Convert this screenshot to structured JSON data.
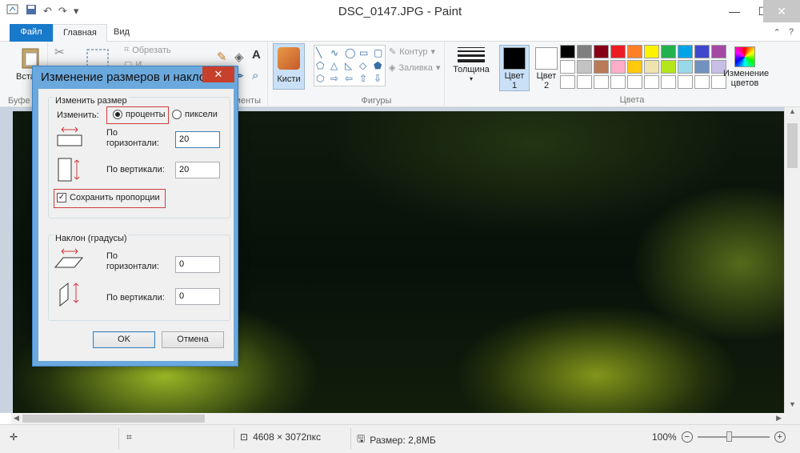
{
  "window": {
    "title": "DSC_0147.JPG - Paint",
    "minimize_glyph": "—",
    "maximize_glyph": "☐",
    "close_glyph": "✕"
  },
  "quick_access": {
    "app_icon": "paint-icon",
    "save_icon": "save-icon",
    "undo_icon": "undo-icon",
    "redo_icon": "redo-icon",
    "dropdown_glyph": "▾"
  },
  "tabs": [
    {
      "label": "Файл"
    },
    {
      "label": "Главная"
    },
    {
      "label": "Вид"
    }
  ],
  "ribbon": {
    "clipboard": {
      "paste_label": "Вста",
      "group_label": "Буфе"
    },
    "image": {
      "crop_label": "Обрезать",
      "resize_label": "И"
    },
    "tools": {
      "group_label": "ументы"
    },
    "brushes_label": "Кисти",
    "shapes": {
      "outline_label": "Контур",
      "fill_label": "Заливка",
      "group_label": "Фигуры"
    },
    "thickness_label": "Толщина",
    "color1": {
      "line1": "Цвет",
      "line2": "1"
    },
    "color2": {
      "line1": "Цвет",
      "line2": "2"
    },
    "colors_group_label": "Цвета",
    "edit_colors": {
      "line1": "Изменение",
      "line2": "цветов"
    },
    "accent_color": "#1979ca"
  },
  "palette": [
    "#000000",
    "#7f7f7f",
    "#880015",
    "#ed1c24",
    "#ff7f27",
    "#fff200",
    "#22b14c",
    "#00a2e8",
    "#3f48cc",
    "#a349a4",
    "#ffffff",
    "#c3c3c3",
    "#b97a57",
    "#ffaec9",
    "#ffc90e",
    "#efe4b0",
    "#b5e61d",
    "#99d9ea",
    "#7092be",
    "#c8bfe7",
    "#ffffff",
    "#ffffff",
    "#ffffff",
    "#ffffff",
    "#ffffff",
    "#ffffff",
    "#ffffff",
    "#ffffff",
    "#ffffff",
    "#ffffff"
  ],
  "dialog": {
    "title": "Изменение размеров и наклона",
    "close_glyph": "✕",
    "resize": {
      "legend": "Изменить размер",
      "by_label": "Изменить:",
      "option_percent": "проценты",
      "option_pixels": "пиксели",
      "selected": "проценты",
      "horizontal_label_1": "По",
      "horizontal_label_2": "горизонтали:",
      "horizontal_value": "20",
      "vertical_label": "По вертикали:",
      "vertical_value": "20",
      "keep_ratio_label": "Сохранить пропорции",
      "keep_ratio_checked": true
    },
    "skew": {
      "legend": "Наклон (градусы)",
      "horizontal_label_1": "По",
      "horizontal_label_2": "горизонтали:",
      "horizontal_value": "0",
      "vertical_label": "По вертикали:",
      "vertical_value": "0"
    },
    "ok_label": "OK",
    "cancel_label": "Отмена"
  },
  "statusbar": {
    "image_size": "4608 × 3072пкс",
    "file_size": "Размер: 2,8МБ",
    "zoom_level": "100%",
    "zoom_out_glyph": "−",
    "zoom_in_glyph": "+"
  }
}
